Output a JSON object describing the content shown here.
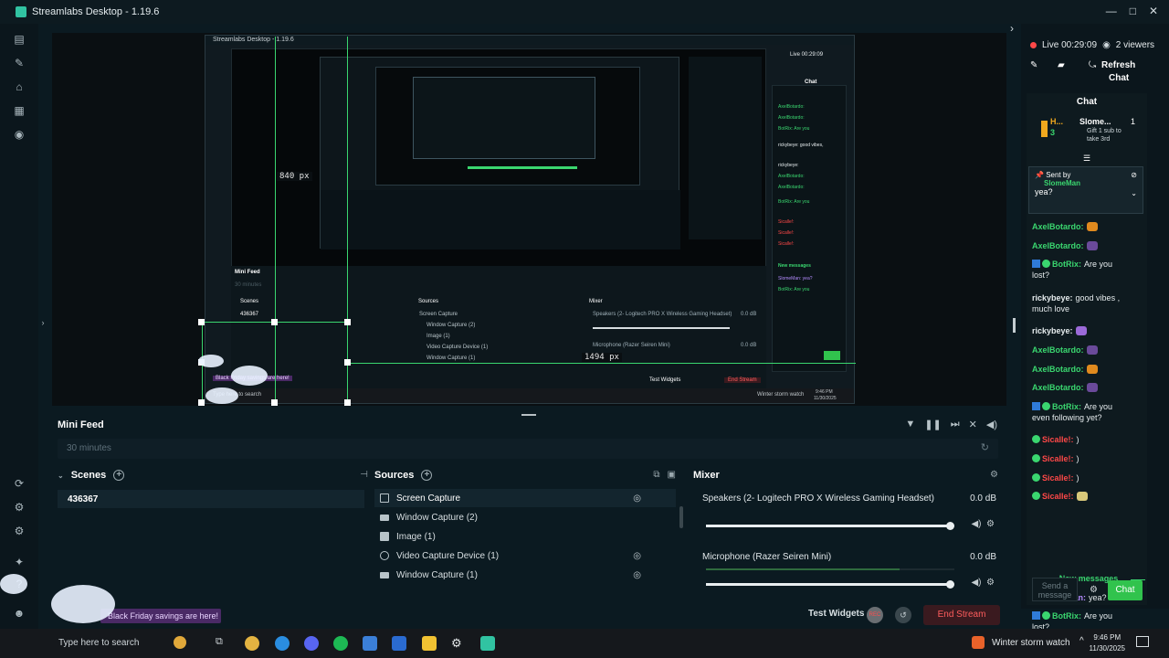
{
  "window": {
    "title": "Streamlabs Desktop - 1.19.6",
    "controls": [
      "—",
      "□",
      "✕"
    ]
  },
  "preview": {
    "measure_vertical": "840 px",
    "measure_horizontal": "1494 px",
    "nested_title": "Streamlabs Desktop - 1.19.6",
    "nested_minifeed": "Mini Feed",
    "nested_minifeed_filter": "30 minutes",
    "nested_scenes": "Scenes",
    "nested_scene_item": "436367",
    "nested_sources": "Sources",
    "nested_mixer": "Mixer",
    "nested_sources_list": [
      "Screen Capture",
      "Window Capture (2)",
      "Image (1)",
      "Video Capture Device (1)",
      "Window Capture (1)"
    ],
    "nested_mixer_a": "Speakers (2- Logitech PRO X Wireless Gaming Headset)",
    "nested_mixer_b": "Microphone (Razer Seiren Mini)",
    "nested_db": "0.0 dB",
    "nested_promo": "Black Friday savings are here!",
    "nested_search": "Type here to search",
    "nested_test_widgets": "Test Widgets",
    "nested_end_stream": "End Stream",
    "nested_weather": "Winter storm watch",
    "nested_clock": "9:46 PM",
    "nested_date": "11/30/2025",
    "nested_live": "Live 00:29:09",
    "nested_chat": "Chat",
    "nested_new_messages": "New messages"
  },
  "minifeed": {
    "title": "Mini Feed",
    "filter_value": "30 minutes"
  },
  "scenes": {
    "title": "Scenes",
    "items": [
      "436367"
    ]
  },
  "sources": {
    "title": "Sources",
    "items": [
      {
        "label": "Screen Capture",
        "selected": true
      },
      {
        "label": "Window Capture (2)",
        "selected": false
      },
      {
        "label": "Image (1)",
        "selected": false
      },
      {
        "label": "Video Capture Device (1)",
        "selected": false
      },
      {
        "label": "Window Capture (1)",
        "selected": false
      }
    ]
  },
  "mixer": {
    "title": "Mixer",
    "channels": [
      {
        "name": "Speakers (2- Logitech PRO X Wireless Gaming Headset)",
        "db": "0.0 dB",
        "level": 0.98
      },
      {
        "name": "Microphone (Razer Seiren Mini)",
        "db": "0.0 dB",
        "level": 0.98
      }
    ]
  },
  "footer": {
    "test_widgets": "Test Widgets",
    "rec": "REC",
    "end_stream": "End Stream"
  },
  "stream": {
    "live_time": "Live 00:29:09",
    "viewers": "2 viewers",
    "refresh_line1": "Refresh",
    "refresh_line2": "Chat"
  },
  "chat": {
    "title": "Chat",
    "goal_user": "H...",
    "goal_user_count": "3",
    "goal_name": "Slome...",
    "goal_count": "1",
    "goal_desc_1": "Gift 1 sub to",
    "goal_desc_2": "take 3rd",
    "pinned_label": "Sent by",
    "pinned_user": "SlomeMan",
    "pinned_text": "yea?",
    "messages": [
      {
        "user": "AxelBotardo:",
        "text": "",
        "color": "#3ad66f",
        "emote": "#e08a1e",
        "badges": ""
      },
      {
        "user": "AxelBotardo:",
        "text": "",
        "color": "#3ad66f",
        "emote": "#6a4a9a",
        "badges": ""
      },
      {
        "user": "BotRix:",
        "text": "Are you",
        "text2": "lost?",
        "color": "#3ad66f",
        "emote": "",
        "badges": "bot"
      },
      {
        "user": "rickybeye:",
        "text": "good vibes ,",
        "text2": "much love",
        "color": "#e6ecee",
        "emote": "",
        "badges": ""
      },
      {
        "user": "rickybeye:",
        "text": "",
        "color": "#e6ecee",
        "emote": "#9b6ad8",
        "badges": ""
      },
      {
        "user": "AxelBotardo:",
        "text": "",
        "color": "#3ad66f",
        "emote": "#6a4a9a",
        "badges": ""
      },
      {
        "user": "AxelBotardo:",
        "text": "",
        "color": "#3ad66f",
        "emote": "#e08a1e",
        "badges": ""
      },
      {
        "user": "AxelBotardo:",
        "text": "",
        "color": "#3ad66f",
        "emote": "#6a4a9a",
        "badges": ""
      },
      {
        "user": "BotRix:",
        "text": "Are you",
        "text2": "even following yet?",
        "color": "#3ad66f",
        "emote": "",
        "badges": "bot"
      },
      {
        "user": "Sicalle!:",
        "text": ")",
        "color": "#ff4848",
        "emote": "",
        "badges": "ok"
      },
      {
        "user": "Sicalle!:",
        "text": ")",
        "color": "#ff4848",
        "emote": "",
        "badges": "ok"
      },
      {
        "user": "Sicalle!:",
        "text": ")",
        "color": "#ff4848",
        "emote": "",
        "badges": "ok"
      },
      {
        "user": "Sicalle!:",
        "text": "",
        "color": "#ff4848",
        "emote": "#d8c87a",
        "badges": "ok"
      }
    ],
    "new_messages": "New messages",
    "after": [
      {
        "user": "SlomeMan:",
        "text": "yea?",
        "color": "#b58cff",
        "badges": "sq"
      },
      {
        "user": "BotRix:",
        "text": "Are you",
        "text2": "lost?",
        "color": "#3ad66f",
        "badges": "bot"
      }
    ],
    "send_placeholder": "Send a message",
    "send_button": "Chat"
  },
  "promo": "Black Friday savings are here!",
  "taskbar": {
    "search": "Type here to search",
    "weather": "Winter storm watch",
    "time": "9:46 PM",
    "date": "11/30/2025"
  },
  "colors": {
    "accent": "#31c3a2",
    "guide": "#3ad66f",
    "live": "#ff4848",
    "end_stream": "#ff5d5d"
  }
}
